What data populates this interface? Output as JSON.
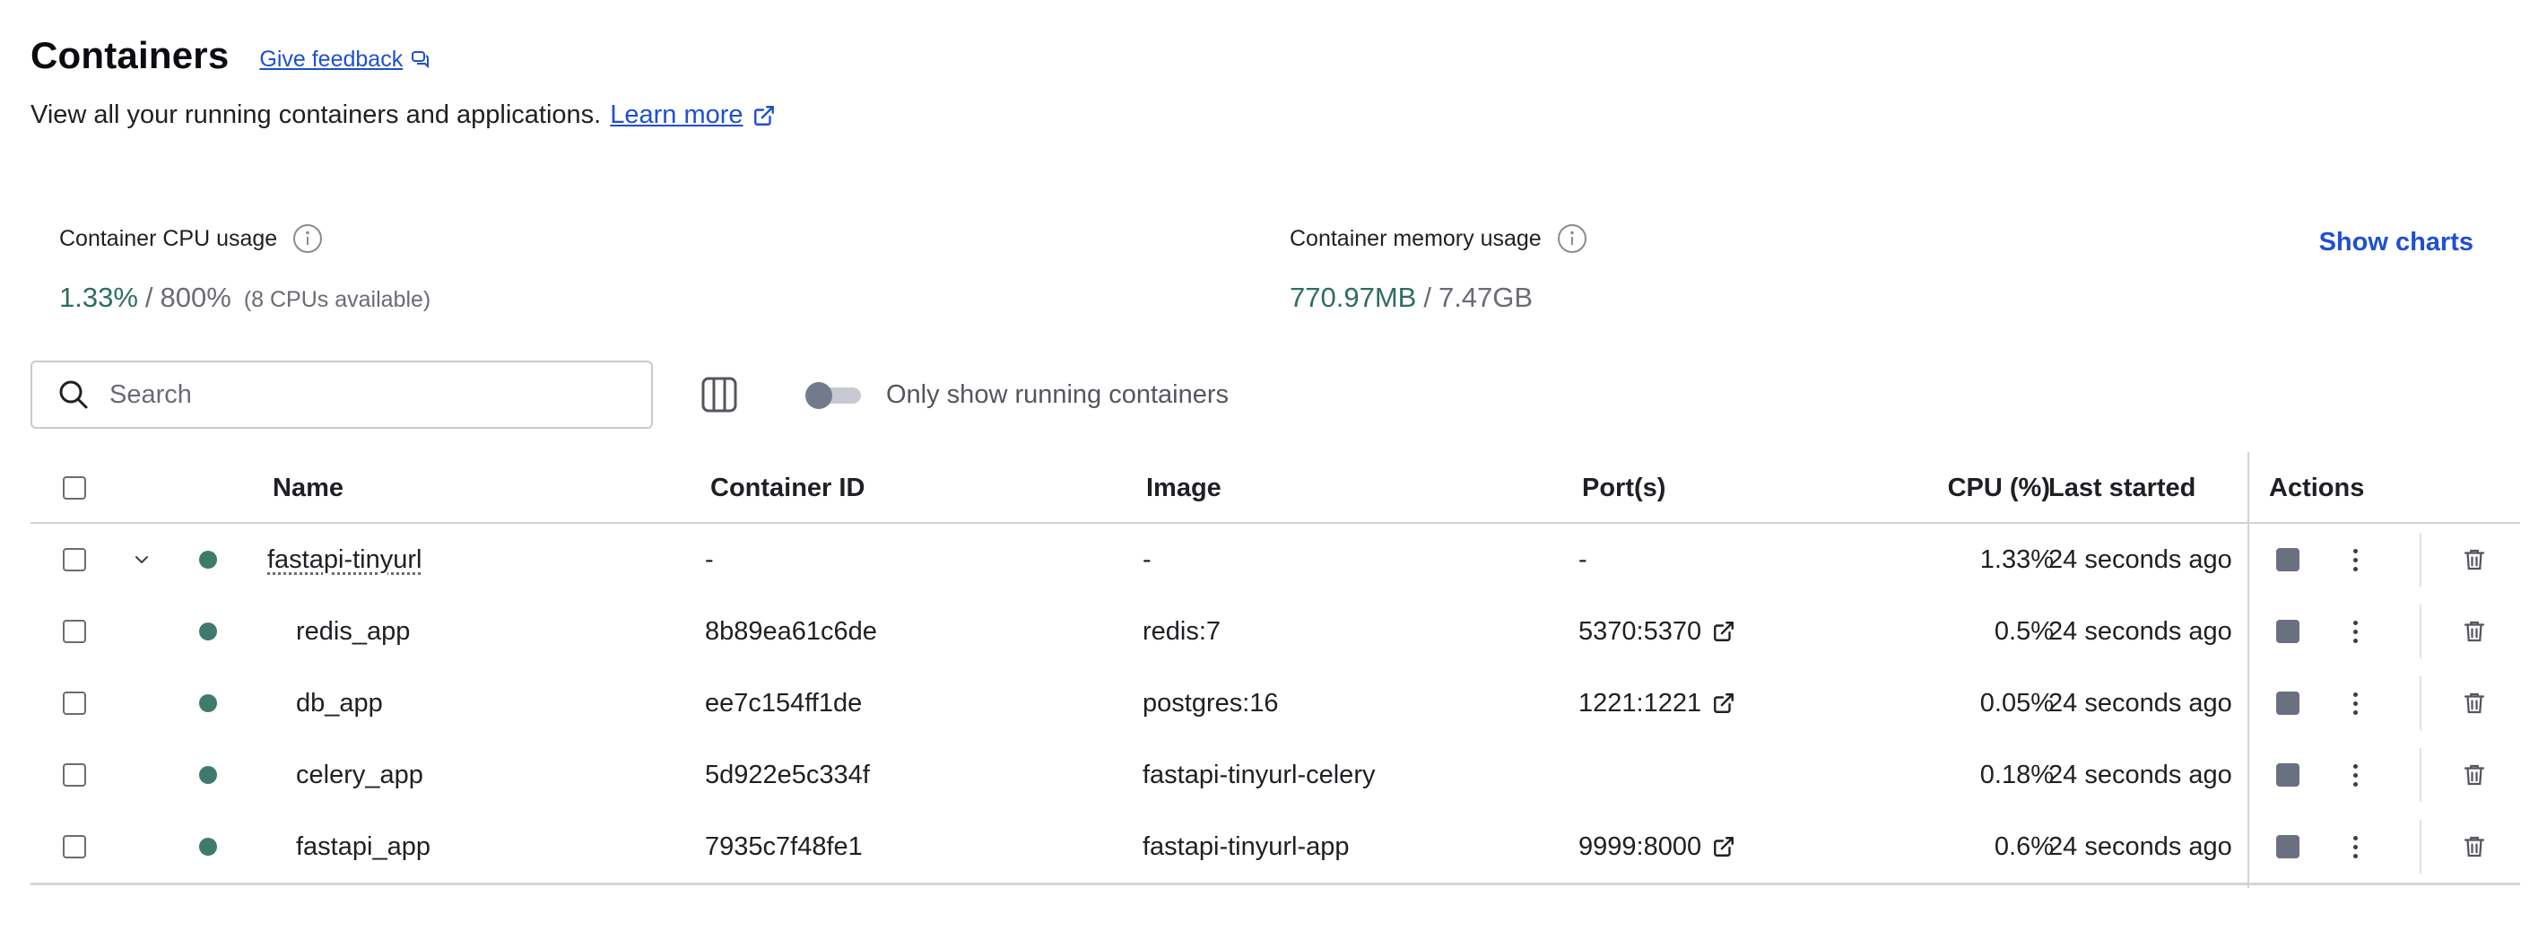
{
  "header": {
    "title": "Containers",
    "feedback_label": "Give feedback",
    "subtitle": "View all your running containers and applications.",
    "learn_more_label": "Learn more"
  },
  "stats": {
    "cpu": {
      "label": "Container CPU usage",
      "used": "1.33%",
      "separator": "/",
      "total": "800%",
      "note": "(8 CPUs available)"
    },
    "memory": {
      "label": "Container memory usage",
      "used": "770.97MB",
      "separator": "/",
      "total": "7.47GB"
    },
    "show_charts_label": "Show charts"
  },
  "toolbar": {
    "search_placeholder": "Search",
    "toggle_label": "Only show running containers",
    "toggle_on": false
  },
  "table": {
    "columns": {
      "name": "Name",
      "container_id": "Container ID",
      "image": "Image",
      "ports": "Port(s)",
      "cpu": "CPU (%)",
      "last_started": "Last started",
      "actions": "Actions"
    },
    "rows": [
      {
        "name": "fastapi-tinyurl",
        "container_id": "-",
        "image": "-",
        "ports": "-",
        "cpu": "1.33%",
        "last_started": "24 seconds ago",
        "status": "running",
        "is_group": true
      },
      {
        "name": "redis_app",
        "container_id": "8b89ea61c6de",
        "image": "redis:7",
        "ports": "5370:5370",
        "cpu": "0.5%",
        "last_started": "24 seconds ago",
        "status": "running"
      },
      {
        "name": "db_app",
        "container_id": "ee7c154ff1de",
        "image": "postgres:16",
        "ports": "1221:1221",
        "cpu": "0.05%",
        "last_started": "24 seconds ago",
        "status": "running"
      },
      {
        "name": "celery_app",
        "container_id": "5d922e5c334f",
        "image": "fastapi-tinyurl-celery",
        "ports": "",
        "cpu": "0.18%",
        "last_started": "24 seconds ago",
        "status": "running"
      },
      {
        "name": "fastapi_app",
        "container_id": "7935c7f48fe1",
        "image": "fastapi-tinyurl-app",
        "ports": "9999:8000",
        "cpu": "0.6%",
        "last_started": "24 seconds ago",
        "status": "running"
      }
    ]
  },
  "colors": {
    "accent": "#1f4fd1",
    "status_running": "#3f7b6d",
    "stat_value": "#2e6e5e"
  }
}
